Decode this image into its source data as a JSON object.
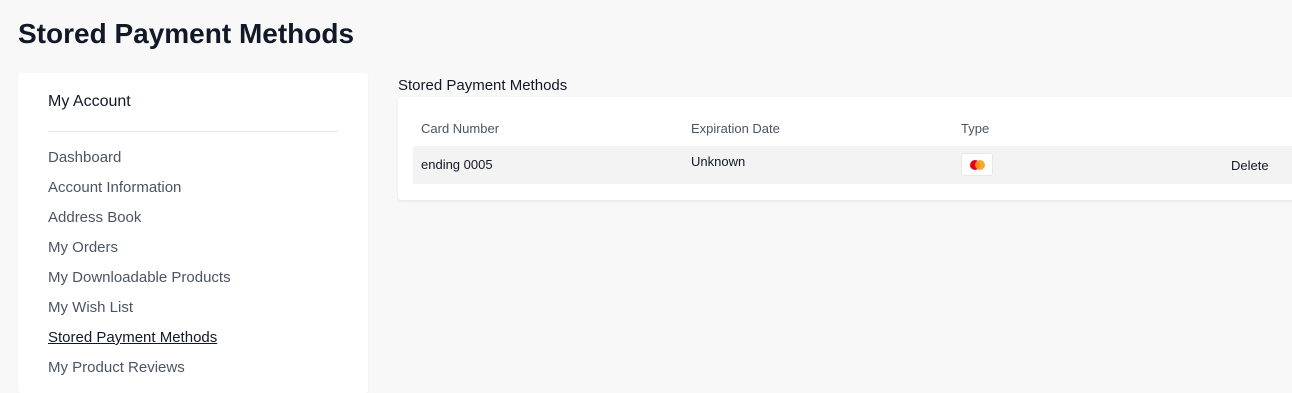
{
  "page": {
    "title": "Stored Payment Methods"
  },
  "sidebar": {
    "title": "My Account",
    "items": [
      {
        "label": "Dashboard"
      },
      {
        "label": "Account Information"
      },
      {
        "label": "Address Book"
      },
      {
        "label": "My Orders"
      },
      {
        "label": "My Downloadable Products"
      },
      {
        "label": "My Wish List"
      },
      {
        "label": "Stored Payment Methods",
        "active": true
      },
      {
        "label": "My Product Reviews"
      }
    ]
  },
  "main": {
    "section_title": "Stored Payment Methods",
    "table": {
      "headers": {
        "card_number": "Card Number",
        "expiration_date": "Expiration Date",
        "type": "Type"
      },
      "rows": [
        {
          "card_number": "ending 0005",
          "expiration_date": "Unknown",
          "type_icon": "mastercard-icon",
          "action": "Delete"
        }
      ]
    }
  },
  "colors": {
    "mastercard_red": "#eb001b",
    "mastercard_orange": "#f79e1b"
  }
}
